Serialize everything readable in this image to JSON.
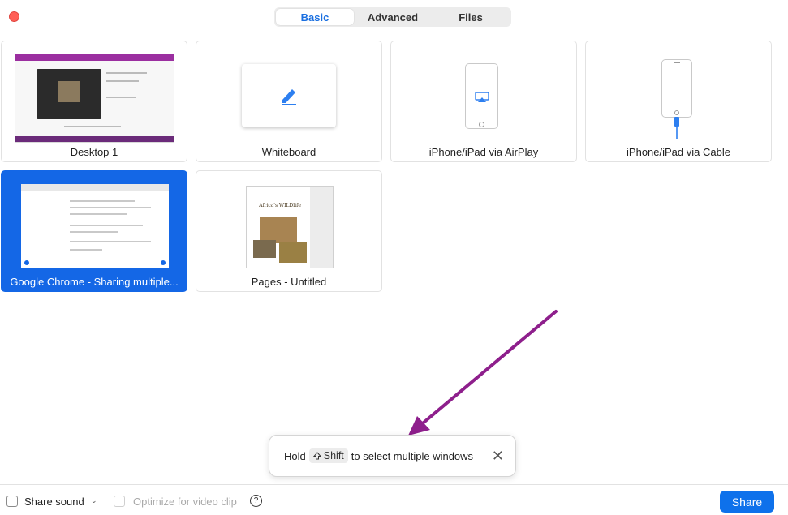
{
  "tabs": [
    {
      "label": "Basic",
      "active": true
    },
    {
      "label": "Advanced",
      "active": false
    },
    {
      "label": "Files",
      "active": false
    }
  ],
  "tiles": {
    "desktop": {
      "label": "Desktop 1"
    },
    "whiteboard": {
      "label": "Whiteboard",
      "icon": "pencil-icon"
    },
    "airplay": {
      "label": "iPhone/iPad via AirPlay",
      "icon": "airplay-icon"
    },
    "cable": {
      "label": "iPhone/iPad via Cable",
      "icon": "lightning-cable-icon"
    },
    "chrome": {
      "label": "Google Chrome - Sharing multiple...",
      "selected": true
    },
    "pages": {
      "label": "Pages - Untitled",
      "doc_title": "Africa's WILDlife"
    }
  },
  "tooltip": {
    "hold": "Hold",
    "key": "Shift",
    "rest": "to select multiple windows"
  },
  "footer": {
    "share_sound": "Share sound",
    "optimize": "Optimize for video clip",
    "help": "?",
    "share_button": "Share"
  },
  "colors": {
    "accent": "#0e71eb",
    "selected_tile": "#1467e6",
    "arrow": "#8e1f8c",
    "close": "#ff5f57"
  }
}
